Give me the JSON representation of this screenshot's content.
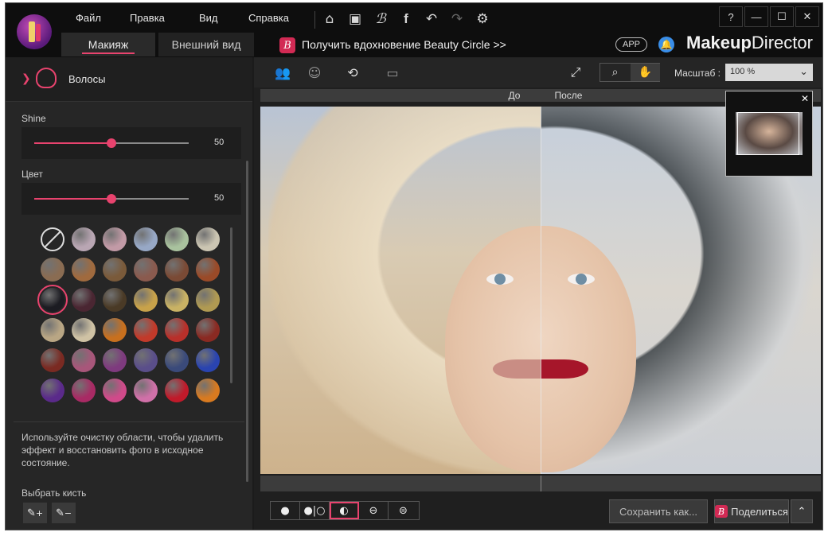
{
  "menu": [
    "Файл",
    "Правка",
    "Вид",
    "Справка"
  ],
  "tabs": {
    "makeup": "Макияж",
    "appearance": "Внешний вид"
  },
  "promo": {
    "icon_letter": "B",
    "text": "Получить вдохновение Beauty Circle >>"
  },
  "app_badge": "APP",
  "brand": {
    "bold": "Makeup",
    "rest": "Director"
  },
  "window_buttons": {
    "help": "?",
    "minimize": "—",
    "maximize": "☐",
    "close": "✕"
  },
  "toolbar_icons": [
    "home-icon",
    "save-icon",
    "beauty-circle-icon",
    "facebook-icon",
    "undo-icon",
    "redo-icon",
    "settings-icon"
  ],
  "panel": {
    "title": "Волосы",
    "shine": {
      "label": "Shine",
      "value": 50
    },
    "color": {
      "label": "Цвет",
      "value": 50
    },
    "swatches": [
      "none",
      "#b9a6b3",
      "#c29aa6",
      "#97a8c6",
      "#a9c29e",
      "#cbc5b2",
      "#8a6c52",
      "#a06a3e",
      "#7a5a3a",
      "#8a5a4e",
      "#7a4a35",
      "#9a4a28",
      "#1c1c22",
      "#4a2632",
      "#4a3a26",
      "#c8a24a",
      "#c9b264",
      "#b09a52",
      "#b9a684",
      "#cfc2a4",
      "#c8701e",
      "#c23a2a",
      "#b8302a",
      "#8a2a22",
      "#7a2a22",
      "#a8567a",
      "#7e3a7e",
      "#5a4e8a",
      "#3a4a7a",
      "#2a44b0",
      "#5a2a8a",
      "#a82a64",
      "#d04a8a",
      "#d070a8",
      "#c01a2a",
      "#d87a20"
    ],
    "selected_swatch": 12,
    "hint": "Используйте очистку области, чтобы удалить эффект и восстановить фото в исходное состояние.",
    "brush_label": "Выбрать кисть"
  },
  "work": {
    "scale_label": "Масштаб :",
    "scale_value": "100 %",
    "before_label": "До",
    "after_label": "После",
    "save_label": "Сохранить как...",
    "share_label": "Поделиться",
    "share_icon_letter": "B"
  },
  "colors": {
    "accent": "#e8436e",
    "brand_b": "#d22a54",
    "bell": "#3a8ee8"
  }
}
